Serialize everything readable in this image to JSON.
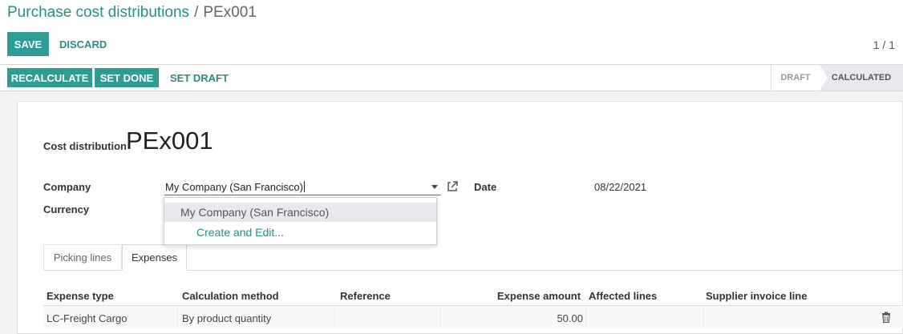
{
  "breadcrumb": {
    "parent": "Purchase cost distributions",
    "separator": "/",
    "current": "PEx001"
  },
  "toolbar": {
    "save_label": "SAVE",
    "discard_label": "DISCARD",
    "pager": "1 / 1"
  },
  "statusbar": {
    "recalculate_label": "RECALCULATE",
    "set_done_label": "SET DONE",
    "set_draft_label": "SET DRAFT",
    "stages": [
      {
        "label": "DRAFT",
        "active": false
      },
      {
        "label": "CALCULATED",
        "active": true
      }
    ]
  },
  "form": {
    "title_label": "Cost distribution",
    "title_value": "PEx001",
    "company_label": "Company",
    "company_value": "My Company (San Francisco)",
    "currency_label": "Currency",
    "date_label": "Date",
    "date_value": "08/22/2021"
  },
  "autocomplete": {
    "options": [
      "My Company (San Francisco)"
    ],
    "create_and_edit": "Create and Edit..."
  },
  "tabs": [
    {
      "label": "Picking lines",
      "active": false
    },
    {
      "label": "Expenses",
      "active": true
    }
  ],
  "expenses_table": {
    "columns": [
      "Expense type",
      "Calculation method",
      "Reference",
      "Expense amount",
      "Affected lines",
      "Supplier invoice line"
    ],
    "rows": [
      {
        "expense_type": "LC-Freight Cargo",
        "calculation_method": "By product quantity",
        "reference": "",
        "expense_amount": "50.00",
        "affected_lines": "",
        "supplier_invoice_line": ""
      }
    ]
  },
  "icons": {
    "external_link": "external-link-icon",
    "dropdown": "chevron-down-icon",
    "delete": "trash-icon"
  },
  "colors": {
    "primary": "#2e9c94",
    "link": "#2a8d88",
    "active_stage_bg": "#e8e9ec"
  }
}
